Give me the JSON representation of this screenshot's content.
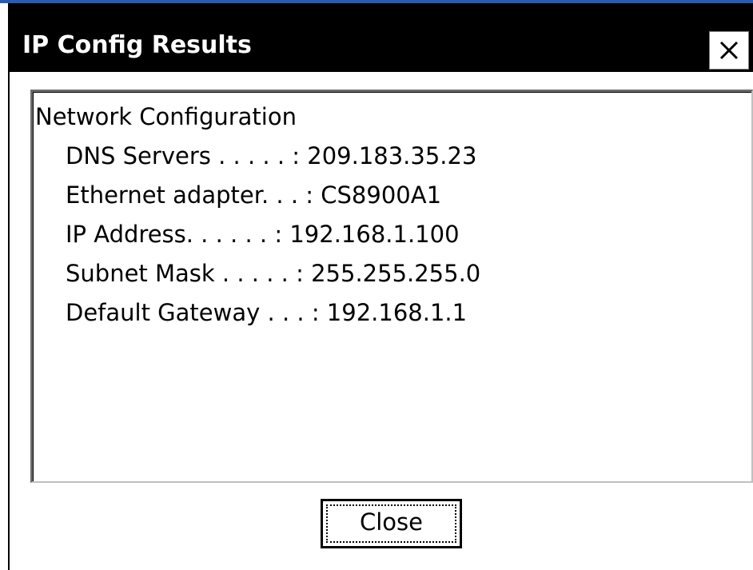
{
  "dialog": {
    "title": "IP Config Results",
    "close_icon": "close-x-icon"
  },
  "results": {
    "heading": "Network Configuration",
    "lines": [
      "DNS Servers . . . . . : 209.183.35.23",
      "Ethernet adapter. . . : CS8900A1",
      "IP Address. . . . . . : 192.168.1.100",
      "Subnet Mask . . . . . : 255.255.255.0",
      "Default Gateway . . . : 192.168.1.1"
    ]
  },
  "buttons": {
    "close_label": "Close"
  },
  "colors": {
    "title_bar": "#000000",
    "title_text": "#ffffff",
    "window_bg": "#ffffff",
    "top_edge": "#2a5db0"
  }
}
